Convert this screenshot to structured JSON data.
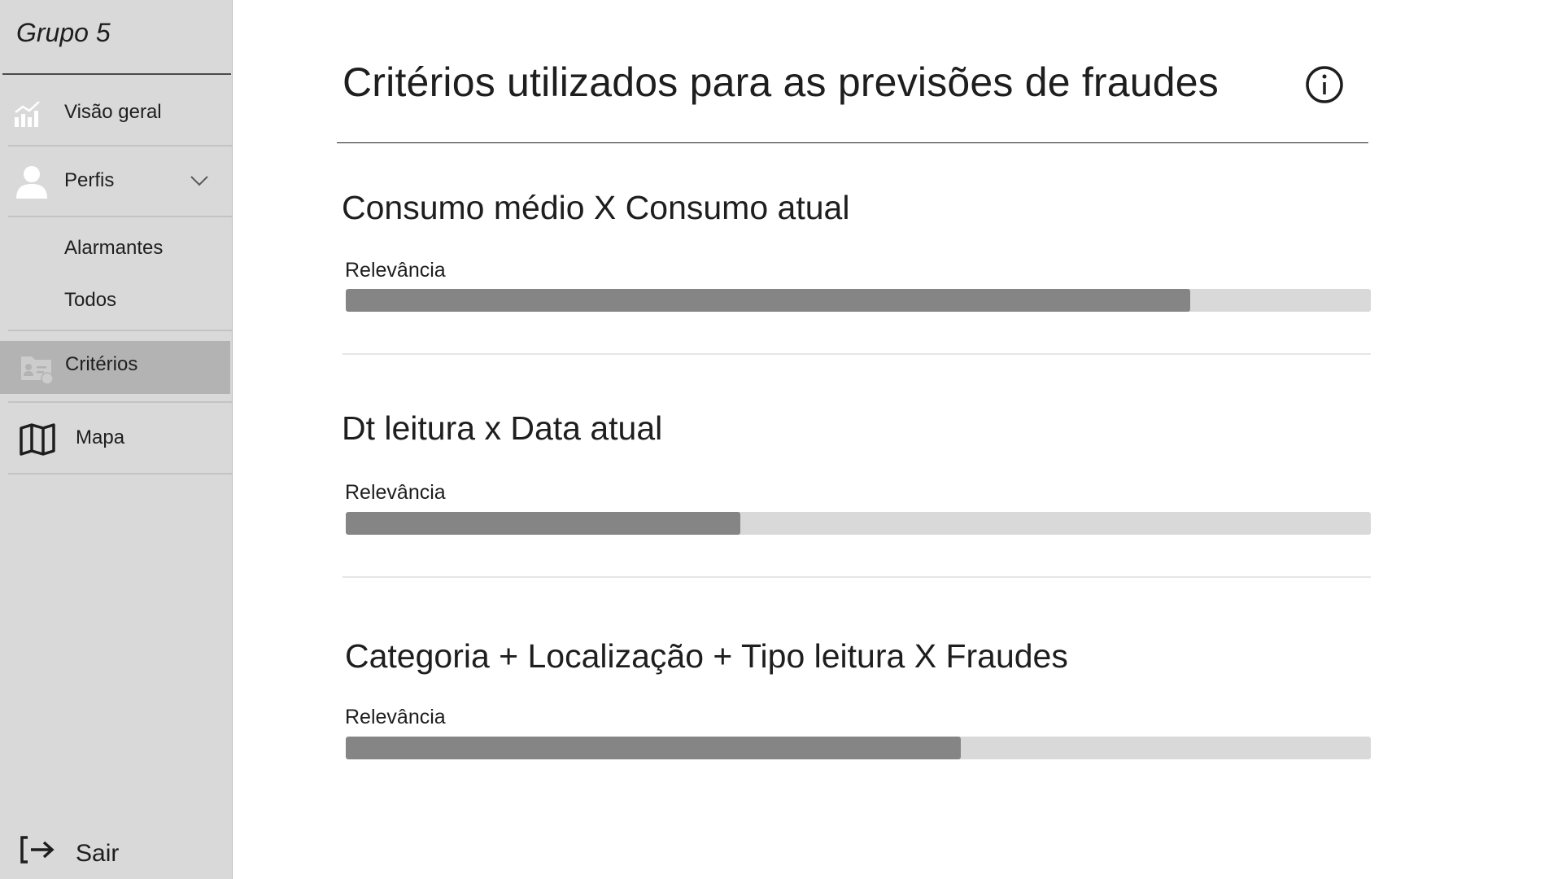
{
  "sidebar": {
    "brand": "Grupo 5",
    "items": [
      {
        "label": "Visão geral",
        "icon": "chart-icon"
      },
      {
        "label": "Perfis",
        "icon": "user-icon"
      },
      {
        "label": "Alarmantes"
      },
      {
        "label": "Todos"
      },
      {
        "label": "Critérios",
        "icon": "user-folder-icon",
        "active": true
      },
      {
        "label": "Mapa",
        "icon": "map-icon"
      }
    ],
    "logout": {
      "label": "Sair",
      "icon": "logout-icon"
    }
  },
  "main": {
    "title": "Critérios utilizados para as previsões de fraudes",
    "criteria": [
      {
        "title": "Consumo médio X Consumo atual",
        "relevance_label": "Relevância",
        "relevance": 0.824
      },
      {
        "title": "Dt leitura x Data atual",
        "relevance_label": "Relevância",
        "relevance": 0.385
      },
      {
        "title": "Categoria + Localização + Tipo leitura X Fraudes",
        "relevance_label": "Relevância",
        "relevance": 0.6
      }
    ]
  },
  "colors": {
    "sidebar_bg": "#d9d9d9",
    "active_bg": "#b3b3b3",
    "bar_track": "#d9d9d9",
    "bar_fill": "#858585"
  }
}
